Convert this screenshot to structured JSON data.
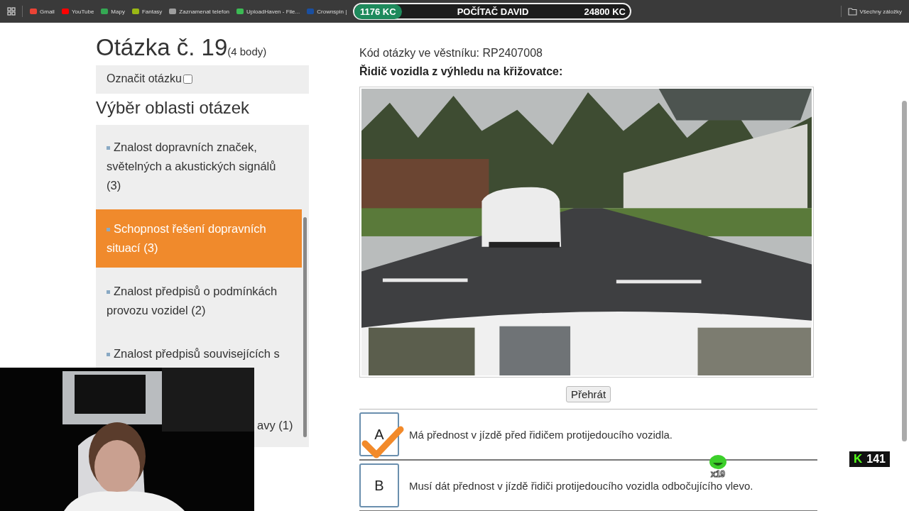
{
  "bookmarks": [
    {
      "label": "Gmail",
      "color": "#ea4335"
    },
    {
      "label": "YouTube",
      "color": "#ff0000"
    },
    {
      "label": "Mapy",
      "color": "#34a853"
    },
    {
      "label": "Fantasy",
      "color": "#9ab814"
    },
    {
      "label": "Zaznamenat telefon",
      "color": "#9e9e9e"
    },
    {
      "label": "UploadHaven - File...",
      "color": "#3cba54"
    },
    {
      "label": "Crownspin |",
      "color": "#1a4fa0"
    }
  ],
  "all_bookmarks": "Všechny záložky",
  "stream_bar": {
    "left": "1176 KC",
    "center": "POČÍTAČ DAVID",
    "right": "24800 KC"
  },
  "question": {
    "title": "Otázka č. 19",
    "points": "(4 body)",
    "mark_label": "Označit otázku",
    "marked": false
  },
  "areas": {
    "title": "Výběr oblasti otázek",
    "items": [
      {
        "label": "Znalost dopravních značek, světelných a akustických signálů (3)",
        "selected": false
      },
      {
        "label": "Schopnost řešení dopravních situací (3)",
        "selected": true
      },
      {
        "label": "Znalost předpisů o podmínkách provozu vozidel (2)",
        "selected": false
      },
      {
        "label": "Znalost předpisů souvisejících s",
        "selected": false
      },
      {
        "label": "avy (1)",
        "selected": false
      }
    ]
  },
  "code": "Kód otázky ve věstníku: RP2407008",
  "prompt": "Řidič vozidla z výhledu na křižovatce:",
  "play_button": "Přehrát",
  "answers": [
    {
      "letter": "A",
      "text": "Má přednost v jízdě před řidičem protijedoucího vozidla.",
      "selected": true
    },
    {
      "letter": "B",
      "text": "Musí dát přednost v jízdě řidiči protijedoucího vozidla odbočujícího vlevo.",
      "selected": false
    }
  ],
  "sticker": "x19",
  "viewer_badge": {
    "logo": "K",
    "count": "141"
  }
}
